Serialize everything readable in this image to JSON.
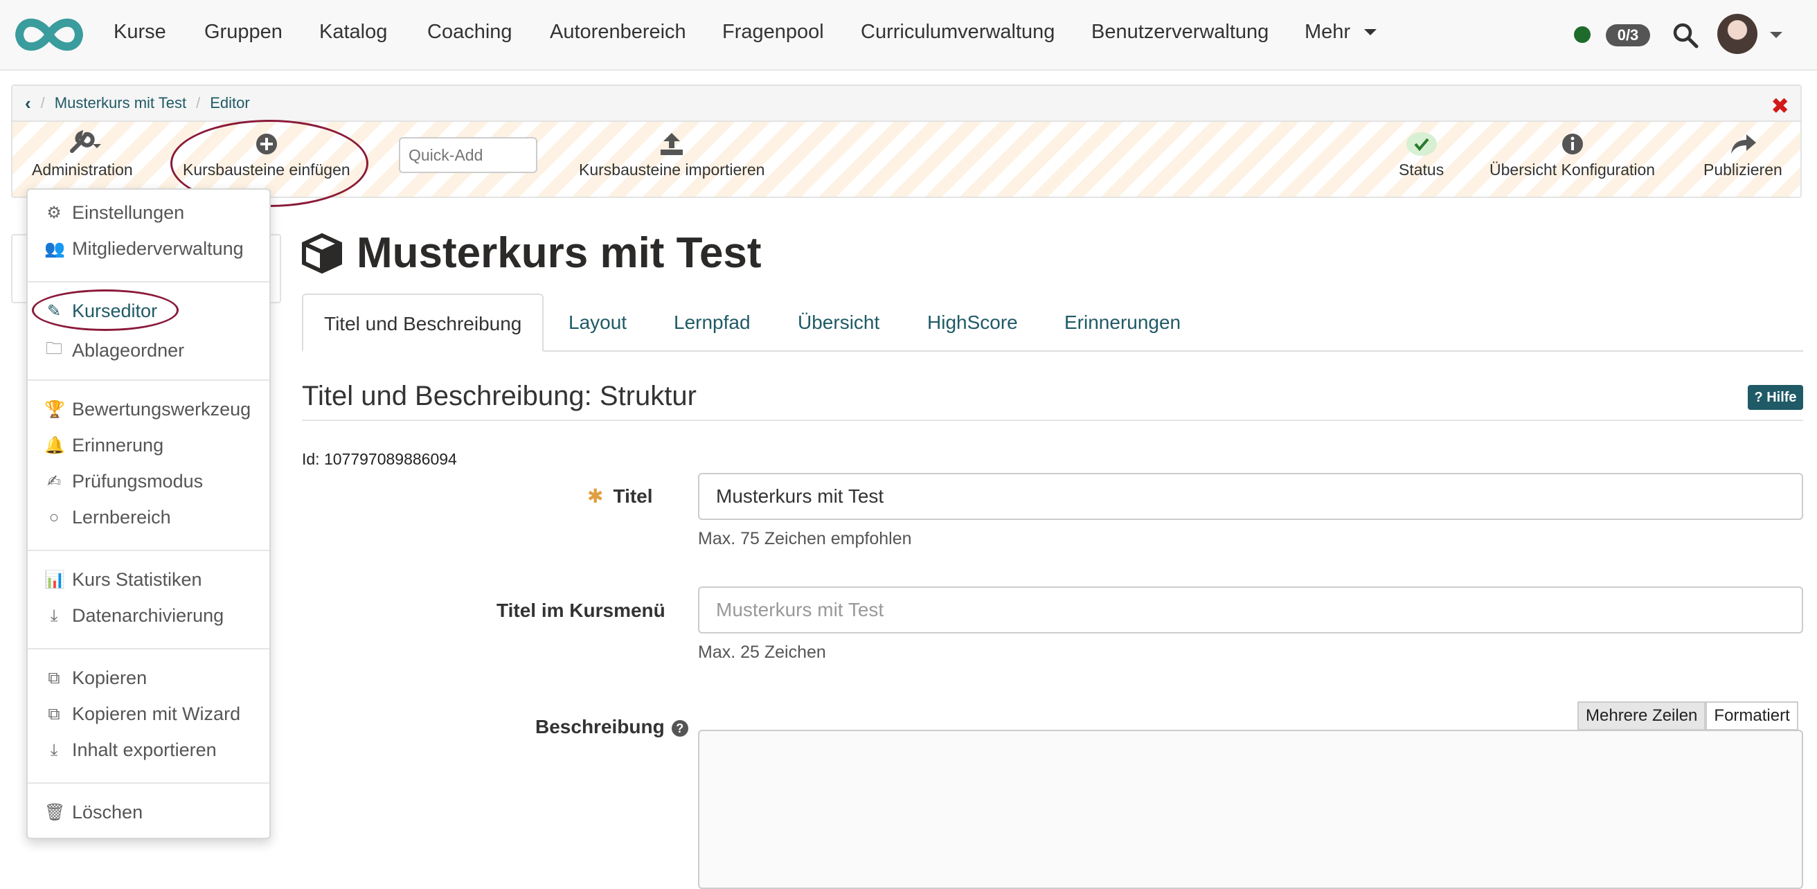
{
  "nav": {
    "items": [
      "Kurse",
      "Gruppen",
      "Katalog",
      "Coaching",
      "Autorenbereich",
      "Fragenpool",
      "Curriculumverwaltung",
      "Benutzerverwaltung"
    ],
    "more_label": "Mehr",
    "count_badge": "0/3",
    "status_color": "#1e6b2c"
  },
  "breadcrumb": {
    "items": [
      "Musterkurs mit Test",
      "Editor"
    ]
  },
  "toolbar": {
    "administration": "Administration",
    "insert_blocks": "Kursbausteine einfügen",
    "quick_add_placeholder": "Quick-Add",
    "import_blocks": "Kursbausteine importieren",
    "status": "Status",
    "overview_config": "Übersicht Konfiguration",
    "publish": "Publizieren"
  },
  "dropdown": {
    "items": [
      {
        "label": "Einstellungen",
        "icon": "gears-icon"
      },
      {
        "label": "Mitgliederverwaltung",
        "icon": "users-icon"
      },
      {
        "label": "Kurseditor",
        "icon": "edit-icon",
        "active": true
      },
      {
        "label": "Ablageordner",
        "icon": "folder-icon"
      },
      {
        "label": "Bewertungswerkzeug",
        "icon": "trophy-icon"
      },
      {
        "label": "Erinnerung",
        "icon": "bell-icon"
      },
      {
        "label": "Prüfungsmodus",
        "icon": "exam-icon"
      },
      {
        "label": "Lernbereich",
        "icon": "circle-icon"
      },
      {
        "label": "Kurs Statistiken",
        "icon": "bar-chart-icon"
      },
      {
        "label": "Datenarchivierung",
        "icon": "download-icon"
      },
      {
        "label": "Kopieren",
        "icon": "copy-icon"
      },
      {
        "label": "Kopieren mit Wizard",
        "icon": "copy-icon"
      },
      {
        "label": "Inhalt exportieren",
        "icon": "download-icon"
      },
      {
        "label": "Löschen",
        "icon": "trash-icon"
      }
    ]
  },
  "main": {
    "course_title": "Musterkurs mit Test",
    "tabs": [
      "Titel und Beschreibung",
      "Layout",
      "Lernpfad",
      "Übersicht",
      "HighScore",
      "Erinnerungen"
    ],
    "active_tab": "Titel und Beschreibung",
    "section_title": "Titel und Beschreibung: Struktur",
    "help_label": "Hilfe",
    "id_text": "Id: 107797089886094",
    "form": {
      "title_label": "Titel",
      "title_value": "Musterkurs mit Test",
      "title_hint": "Max. 75 Zeichen empfohlen",
      "menu_title_label": "Titel im Kursmenü",
      "menu_title_placeholder": "Musterkurs mit Test",
      "menu_title_hint": "Max. 25 Zeichen",
      "description_label": "Beschreibung",
      "mode_multiline": "Mehrere Zeilen",
      "mode_formatted": "Formatiert"
    }
  }
}
